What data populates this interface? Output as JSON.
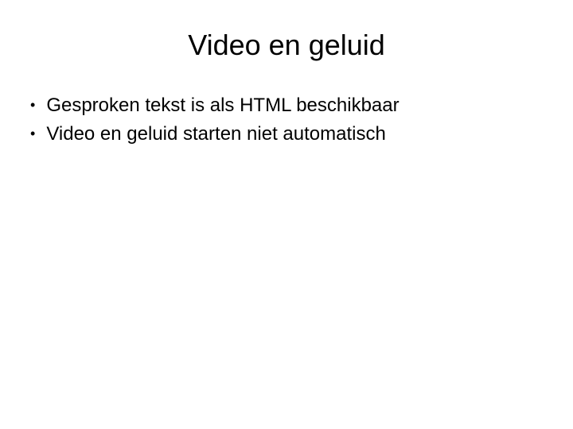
{
  "slide": {
    "title": "Video en geluid",
    "bullets": [
      "Gesproken tekst is als HTML beschikbaar",
      "Video en geluid starten niet automatisch"
    ]
  }
}
